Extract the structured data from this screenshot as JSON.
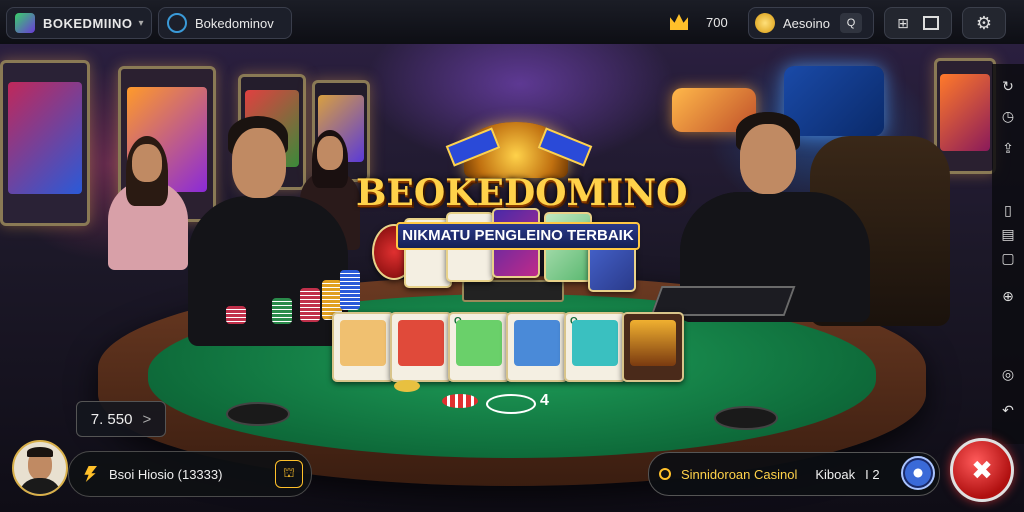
{
  "topbar": {
    "app_name": "BOKEDMIINO",
    "app_caret": "▾",
    "tab_label": "Bokedominov",
    "coins": "700",
    "currency_label": "Aesoino",
    "currency_action": "Q"
  },
  "logo": {
    "title": "BEOKEDOMINO",
    "subtitle": "NIKMATU PENGLEINO TERBAIK"
  },
  "table": {
    "pot_value": "4"
  },
  "hud": {
    "bet_value": "7. 550",
    "bet_arrow": ">",
    "player_info": "Bsoi Hiosio (13333)",
    "status_label": "Sinnidoroan Casinol",
    "status_extra": "Kiboak",
    "status_count": "I 2"
  },
  "colors": {
    "accent_gold": "#ffd24a",
    "felt_green": "#0e6b3a",
    "exit_red": "#c81414"
  },
  "icons": {
    "rail": [
      "refresh-icon",
      "history-icon",
      "share-icon",
      "chat-icon",
      "layout-icon",
      "info-icon",
      "profile-icon",
      "sound-icon",
      "back-icon"
    ]
  }
}
